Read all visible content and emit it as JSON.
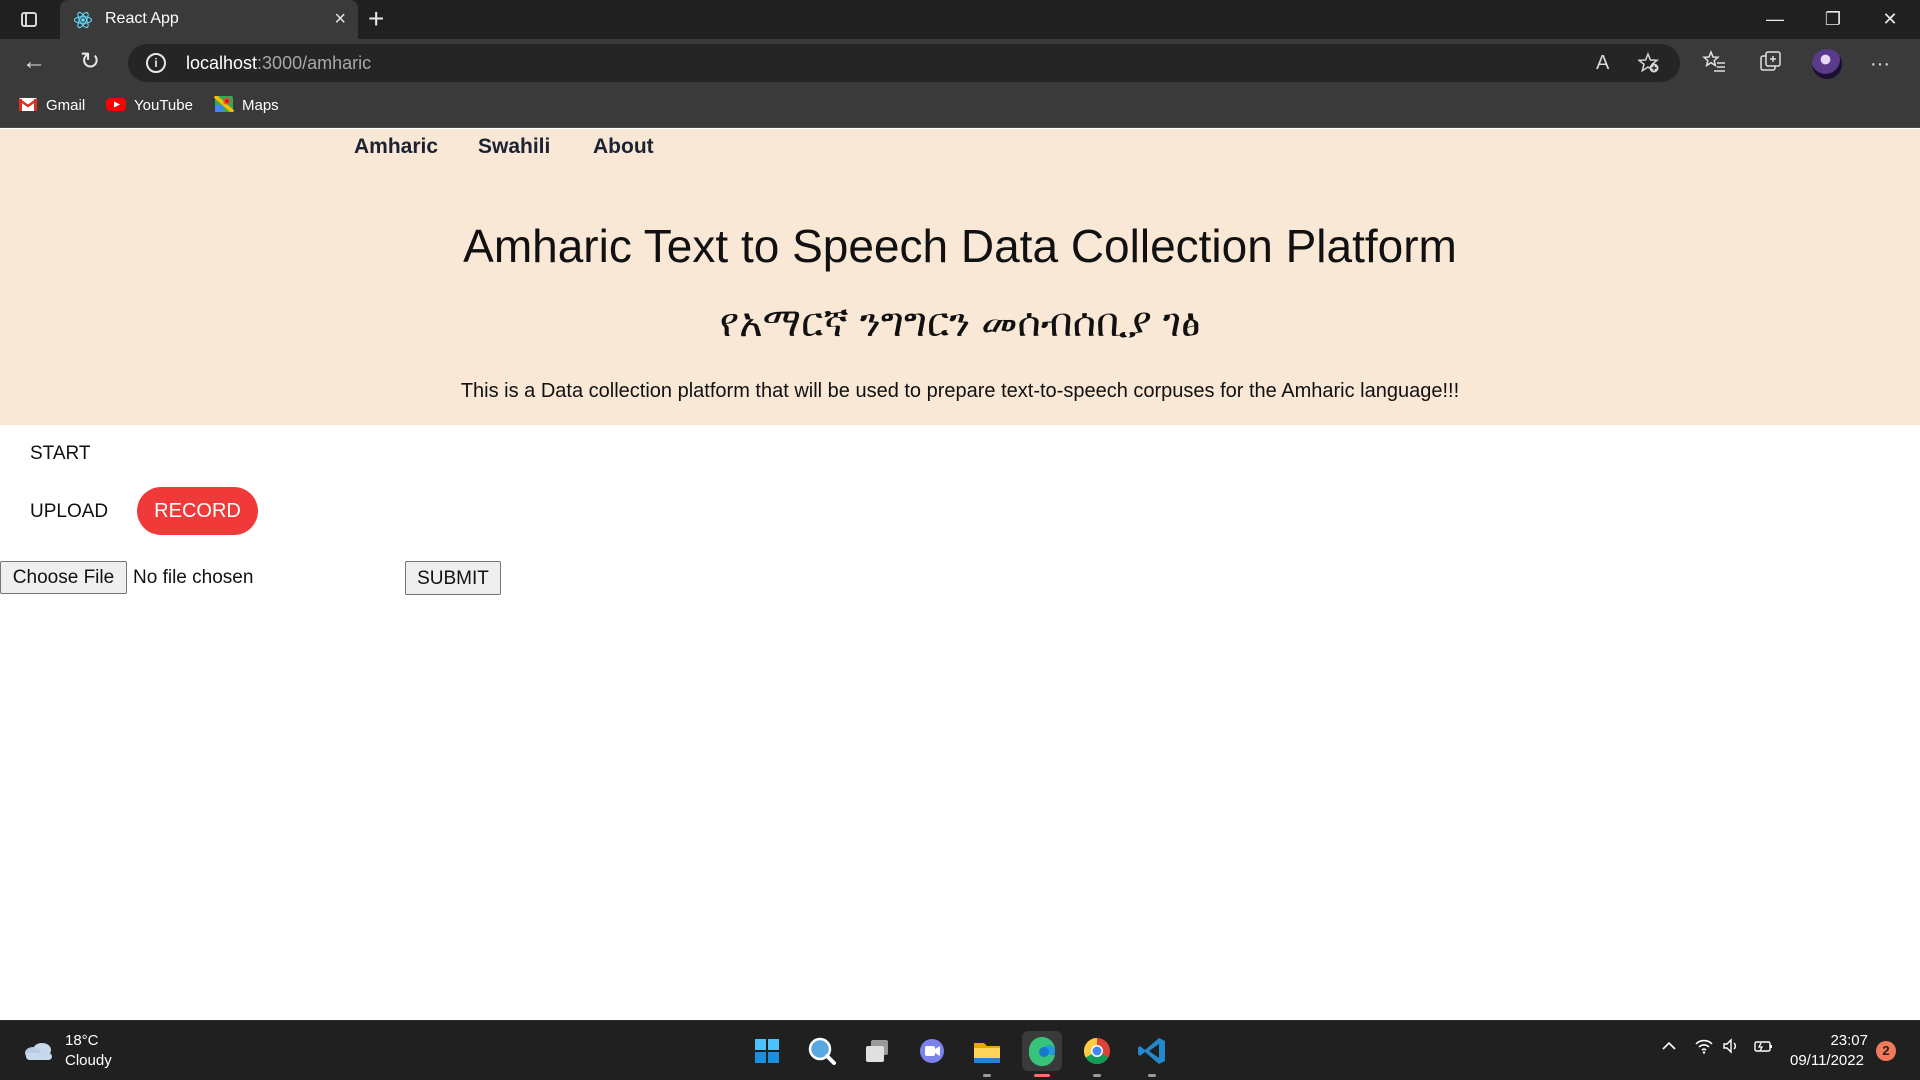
{
  "browser": {
    "tab_title": "React App",
    "tab_close": "×",
    "new_tab": "+",
    "window_controls": {
      "minimize": "—",
      "restore": "❐",
      "close": "✕"
    },
    "nav": {
      "back": "←",
      "refresh": "↻"
    },
    "url_host": "localhost",
    "url_path": ":3000/amharic",
    "read_aloud": "A",
    "more": "···",
    "bookmarks": [
      "Gmail",
      "YouTube",
      "Maps"
    ]
  },
  "page": {
    "nav_links": [
      "Amharic",
      "Swahili",
      "About"
    ],
    "title": "Amharic Text to Speech Data Collection Platform",
    "subtitle_amharic": "የአማርኛ ንግግርን መሰብሰቢያ ገፅ",
    "description": "This is a Data collection platform that will be used to prepare text-to-speech corpuses for the Amharic language!!!",
    "start_label": "START",
    "upload_label": "UPLOAD",
    "record_button": "RECORD",
    "choose_file_button": "Choose File",
    "file_status": "No file chosen",
    "submit_button": "SUBMIT",
    "colors": {
      "hero_bg": "#f9e8d5",
      "record_bg": "#f03a3a"
    }
  },
  "taskbar": {
    "weather_temp": "18°C",
    "weather_condition": "Cloudy",
    "apps": [
      "start-icon",
      "search-icon",
      "task-view-icon",
      "chat-icon",
      "file-explorer-icon",
      "edge-icon",
      "chrome-icon",
      "vscode-icon"
    ],
    "time": "23:07",
    "date": "09/11/2022",
    "notification_count": "2"
  }
}
